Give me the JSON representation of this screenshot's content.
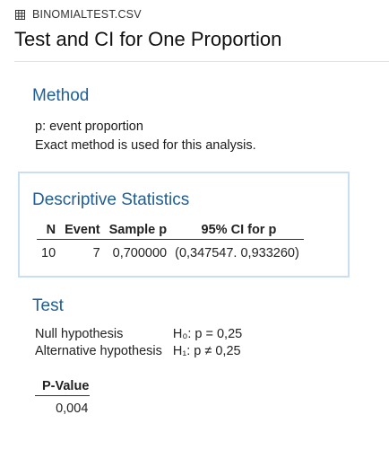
{
  "file": {
    "icon": "table-grid-icon",
    "name": "BINOMIALTEST.CSV"
  },
  "title": "Test and CI for One Proportion",
  "colors": {
    "accent": "#1f5e96",
    "box_border": "#c9def2"
  },
  "method": {
    "heading": "Method",
    "lines": [
      "p: event proportion",
      "Exact method is used for this analysis."
    ]
  },
  "descriptive": {
    "heading": "Descriptive Statistics",
    "columns": [
      "N",
      "Event",
      "Sample p",
      "95% CI for p"
    ],
    "row": [
      "10",
      "7",
      "0,700000",
      "(0,347547. 0,933260)"
    ]
  },
  "test": {
    "heading": "Test",
    "null_label": "Null hypothesis",
    "null_value": "H₀: p = 0,25",
    "alt_label": "Alternative hypothesis",
    "alt_value": "H₁: p ≠ 0,25",
    "pvalue_header": "P-Value",
    "pvalue": "0,004"
  }
}
